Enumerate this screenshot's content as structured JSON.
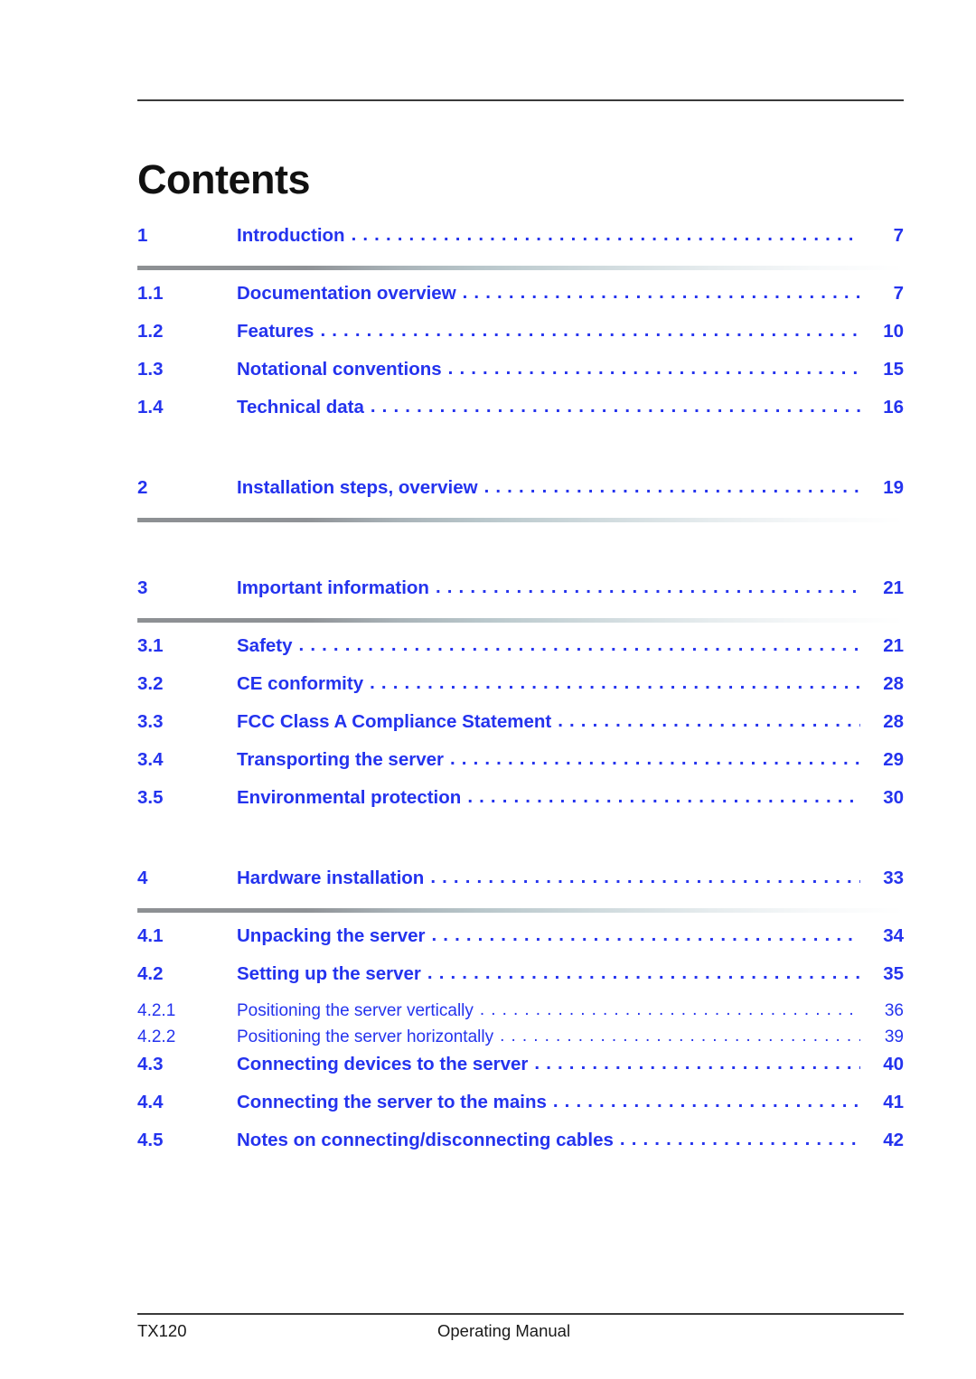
{
  "document": {
    "title": "Contents",
    "accent_color": "#2433ee",
    "title_color": "#111111",
    "rule_color": "#3a3a3a"
  },
  "toc": {
    "entries": [
      {
        "number": "1",
        "label": "Introduction",
        "page": "7",
        "level": 1
      },
      {
        "number": "1.1",
        "label": "Documentation overview",
        "page": "7",
        "level": 2
      },
      {
        "number": "1.2",
        "label": "Features",
        "page": "10",
        "level": 2
      },
      {
        "number": "1.3",
        "label": "Notational conventions",
        "page": "15",
        "level": 2
      },
      {
        "number": "1.4",
        "label": "Technical data",
        "page": "16",
        "level": 2
      },
      {
        "number": "2",
        "label": "Installation steps, overview",
        "page": "19",
        "level": 1
      },
      {
        "number": "3",
        "label": "Important information",
        "page": "21",
        "level": 1
      },
      {
        "number": "3.1",
        "label": "Safety",
        "page": "21",
        "level": 2
      },
      {
        "number": "3.2",
        "label": "CE conformity",
        "page": "28",
        "level": 2
      },
      {
        "number": "3.3",
        "label": "FCC Class A Compliance Statement",
        "page": "28",
        "level": 2
      },
      {
        "number": "3.4",
        "label": "Transporting the server",
        "page": "29",
        "level": 2
      },
      {
        "number": "3.5",
        "label": "Environmental protection",
        "page": "30",
        "level": 2
      },
      {
        "number": "4",
        "label": "Hardware installation",
        "page": "33",
        "level": 1
      },
      {
        "number": "4.1",
        "label": "Unpacking the server",
        "page": "34",
        "level": 2
      },
      {
        "number": "4.2",
        "label": "Setting up the server",
        "page": "35",
        "level": 2
      },
      {
        "number": "4.2.1",
        "label": "Positioning the server vertically",
        "page": "36",
        "level": 3
      },
      {
        "number": "4.2.2",
        "label": "Positioning the server horizontally",
        "page": "39",
        "level": 3
      },
      {
        "number": "4.3",
        "label": "Connecting devices to the server",
        "page": "40",
        "level": 2
      },
      {
        "number": "4.4",
        "label": "Connecting the server to the mains",
        "page": "41",
        "level": 2
      },
      {
        "number": "4.5",
        "label": "Notes on connecting/disconnecting cables",
        "page": "42",
        "level": 2
      }
    ]
  },
  "footer": {
    "left": "TX120",
    "center": "Operating Manual"
  }
}
